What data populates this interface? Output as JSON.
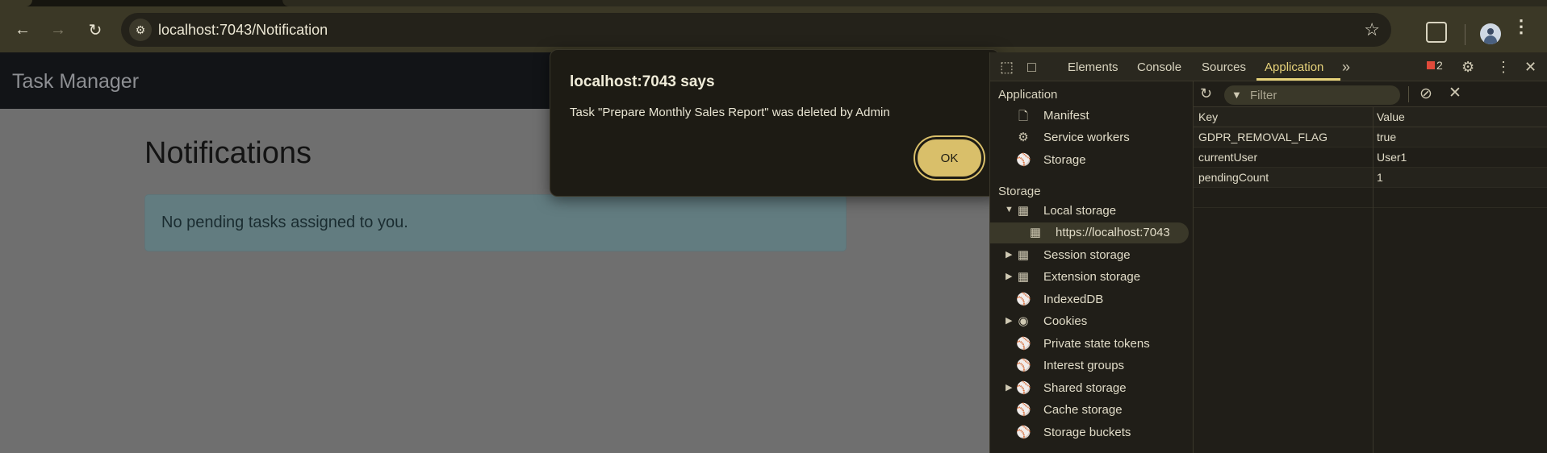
{
  "browser": {
    "url": "localhost:7043/Notification"
  },
  "page": {
    "brand": "Task Manager",
    "title": "Notifications",
    "alert_text": "No pending tasks assigned to you."
  },
  "dialog": {
    "title": "localhost:7043 says",
    "message": "Task \"Prepare Monthly Sales Report\" was deleted by Admin",
    "ok_label": "OK"
  },
  "devtools": {
    "tabs": [
      "Elements",
      "Console",
      "Sources",
      "Application"
    ],
    "active_tab": "Application",
    "issues_count": "2",
    "sidebar": {
      "application_heading": "Application",
      "application_items": [
        "Manifest",
        "Service workers",
        "Storage"
      ],
      "storage_heading": "Storage",
      "storage_items": [
        "Local storage",
        "https://localhost:7043",
        "Session storage",
        "Extension storage",
        "IndexedDB",
        "Cookies",
        "Private state tokens",
        "Interest groups",
        "Shared storage",
        "Cache storage",
        "Storage buckets"
      ]
    },
    "filter_placeholder": "Filter",
    "table": {
      "columns": [
        "Key",
        "Value"
      ],
      "rows": [
        {
          "key": "GDPR_REMOVAL_FLAG",
          "value": "true"
        },
        {
          "key": "currentUser",
          "value": "User1"
        },
        {
          "key": "pendingCount",
          "value": "1"
        }
      ]
    }
  }
}
